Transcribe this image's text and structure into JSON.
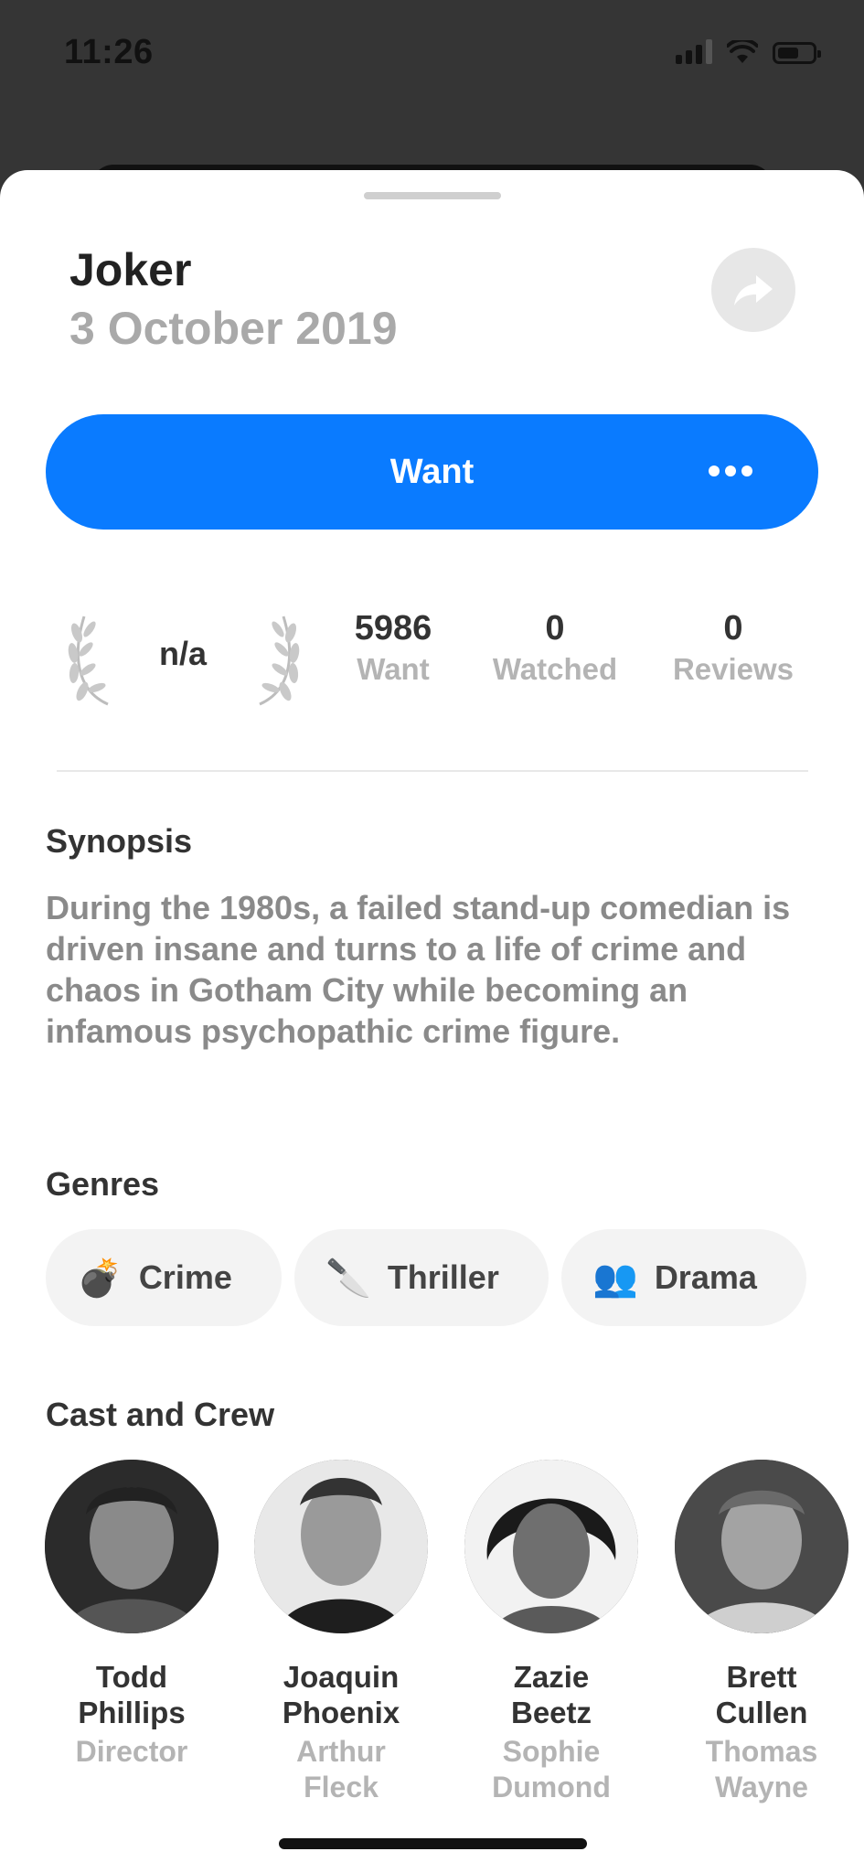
{
  "status_bar": {
    "time": "11:26"
  },
  "movie": {
    "title": "Joker",
    "release_date": "3 October 2019"
  },
  "actions": {
    "want_label": "Want"
  },
  "stats": {
    "rating": "n/a",
    "want_count": "5986",
    "want_label": "Want",
    "watched_count": "0",
    "watched_label": "Watched",
    "reviews_count": "0",
    "reviews_label": "Reviews"
  },
  "synopsis": {
    "heading": "Synopsis",
    "text": "During the 1980s, a failed stand-up comedian is driven insane and turns to a life of crime and chaos in Gotham City while becoming an infamous psychopathic crime figure."
  },
  "genres": {
    "heading": "Genres",
    "items": [
      {
        "emoji": "💣",
        "label": "Crime"
      },
      {
        "emoji": "🔪",
        "label": "Thriller"
      },
      {
        "emoji": "👥",
        "label": "Drama"
      }
    ]
  },
  "cast": {
    "heading": "Cast and Crew",
    "people": [
      {
        "first": "Todd",
        "last": "Phillips",
        "role1": "Director",
        "role2": ""
      },
      {
        "first": "Joaquin",
        "last": "Phoenix",
        "role1": "Arthur",
        "role2": "Fleck"
      },
      {
        "first": "Zazie",
        "last": "Beetz",
        "role1": "Sophie",
        "role2": "Dumond"
      },
      {
        "first": "Brett",
        "last": "Cullen",
        "role1": "Thomas",
        "role2": "Wayne"
      }
    ]
  },
  "colors": {
    "accent": "#0a7bff",
    "muted_text": "#b4b4b4"
  }
}
